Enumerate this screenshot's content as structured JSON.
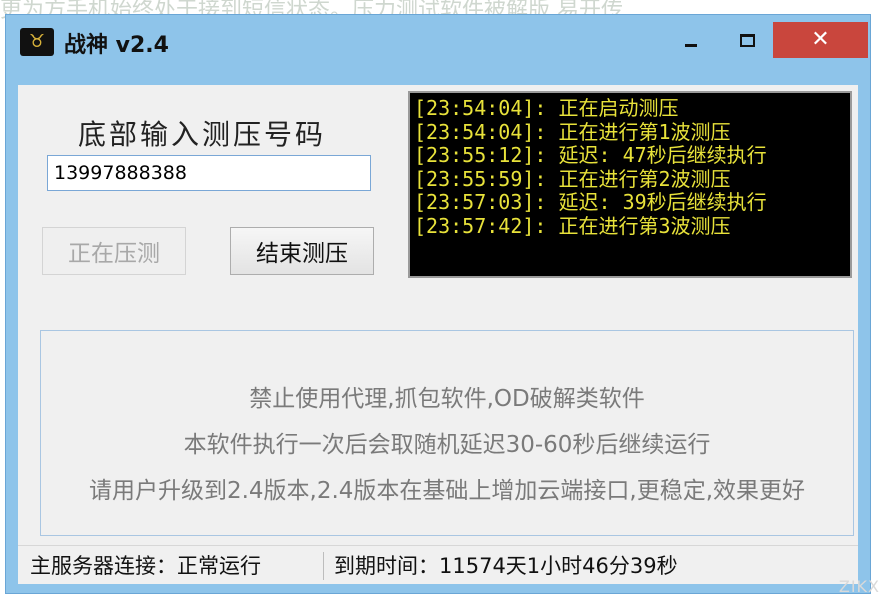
{
  "background_text": "更为方手机始终处于接到短信状态。压力测试软件被解版,易开传",
  "window": {
    "title": "战神 v2.4",
    "controls": {
      "minimize": "minimize",
      "maximize": "maximize",
      "close": "✕"
    }
  },
  "form": {
    "label": "底部输入测压号码",
    "phone_value": "13997888388",
    "testing_button": "正在压测",
    "stop_button": "结束测压"
  },
  "log": [
    "[23:54:04]: 正在启动测压",
    "[23:54:04]: 正在进行第1波测压",
    "[23:55:12]: 延迟: 47秒后继续执行",
    "[23:55:59]: 正在进行第2波测压",
    "[23:57:03]: 延迟: 39秒后继续执行",
    "[23:57:42]: 正在进行第3波测压"
  ],
  "notice": [
    "禁止使用代理,抓包软件,OD破解类软件",
    "本软件执行一次后会取随机延迟30-60秒后继续运行",
    "请用户升级到2.4版本,2.4版本在基础上增加云端接口,更稳定,效果更好"
  ],
  "status": {
    "server": "主服务器连接：正常运行",
    "expiry": "到期时间：11574天1小时46分39秒"
  },
  "watermark": "ZIKX",
  "colors": {
    "title_bg": "#8ec4ea",
    "close_red": "#c9463d",
    "log_text": "#e8e23a",
    "log_bg": "#000000"
  }
}
